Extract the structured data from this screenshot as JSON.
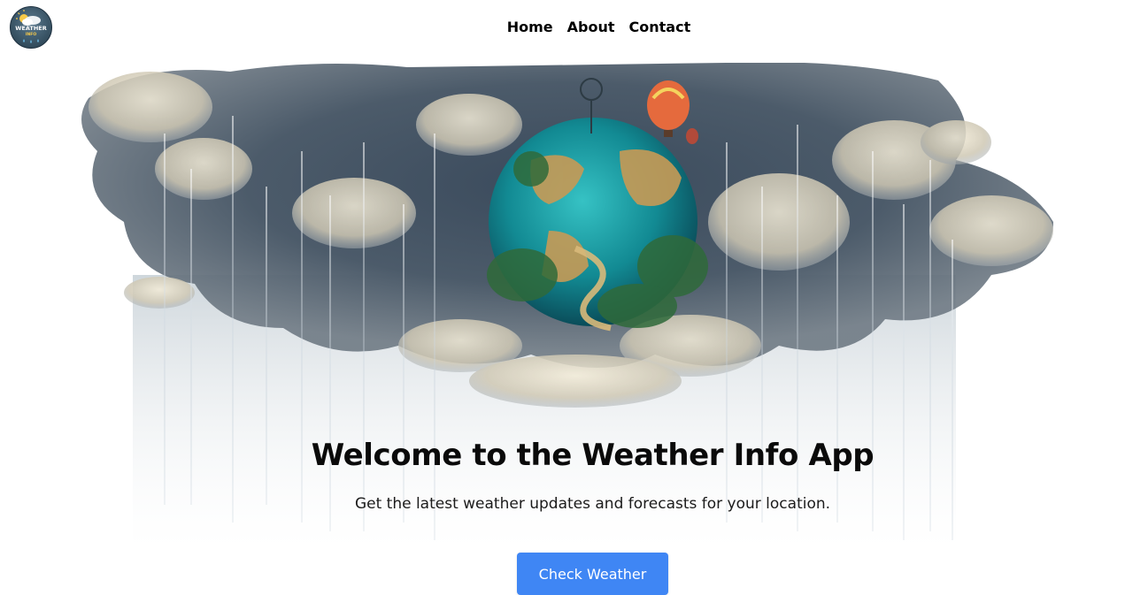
{
  "nav": {
    "logo_text_line1": "WEATHER",
    "logo_text_line2": "INFO",
    "links": [
      {
        "label": "Home"
      },
      {
        "label": "About"
      },
      {
        "label": "Contact"
      }
    ]
  },
  "hero": {
    "title": "Welcome to the Weather Info App",
    "subtitle": "Get the latest weather updates and forecasts for your location.",
    "cta_label": "Check Weather"
  },
  "icons": {
    "logo": "weather-logo-icon",
    "hero_image": "globe-storm-cloud-illustration"
  },
  "colors": {
    "accent": "#3f86f4",
    "text": "#0a0a0a",
    "background": "#ffffff",
    "cloud_dark": "#2e3b4c",
    "globe_teal": "#1aa3a8"
  }
}
